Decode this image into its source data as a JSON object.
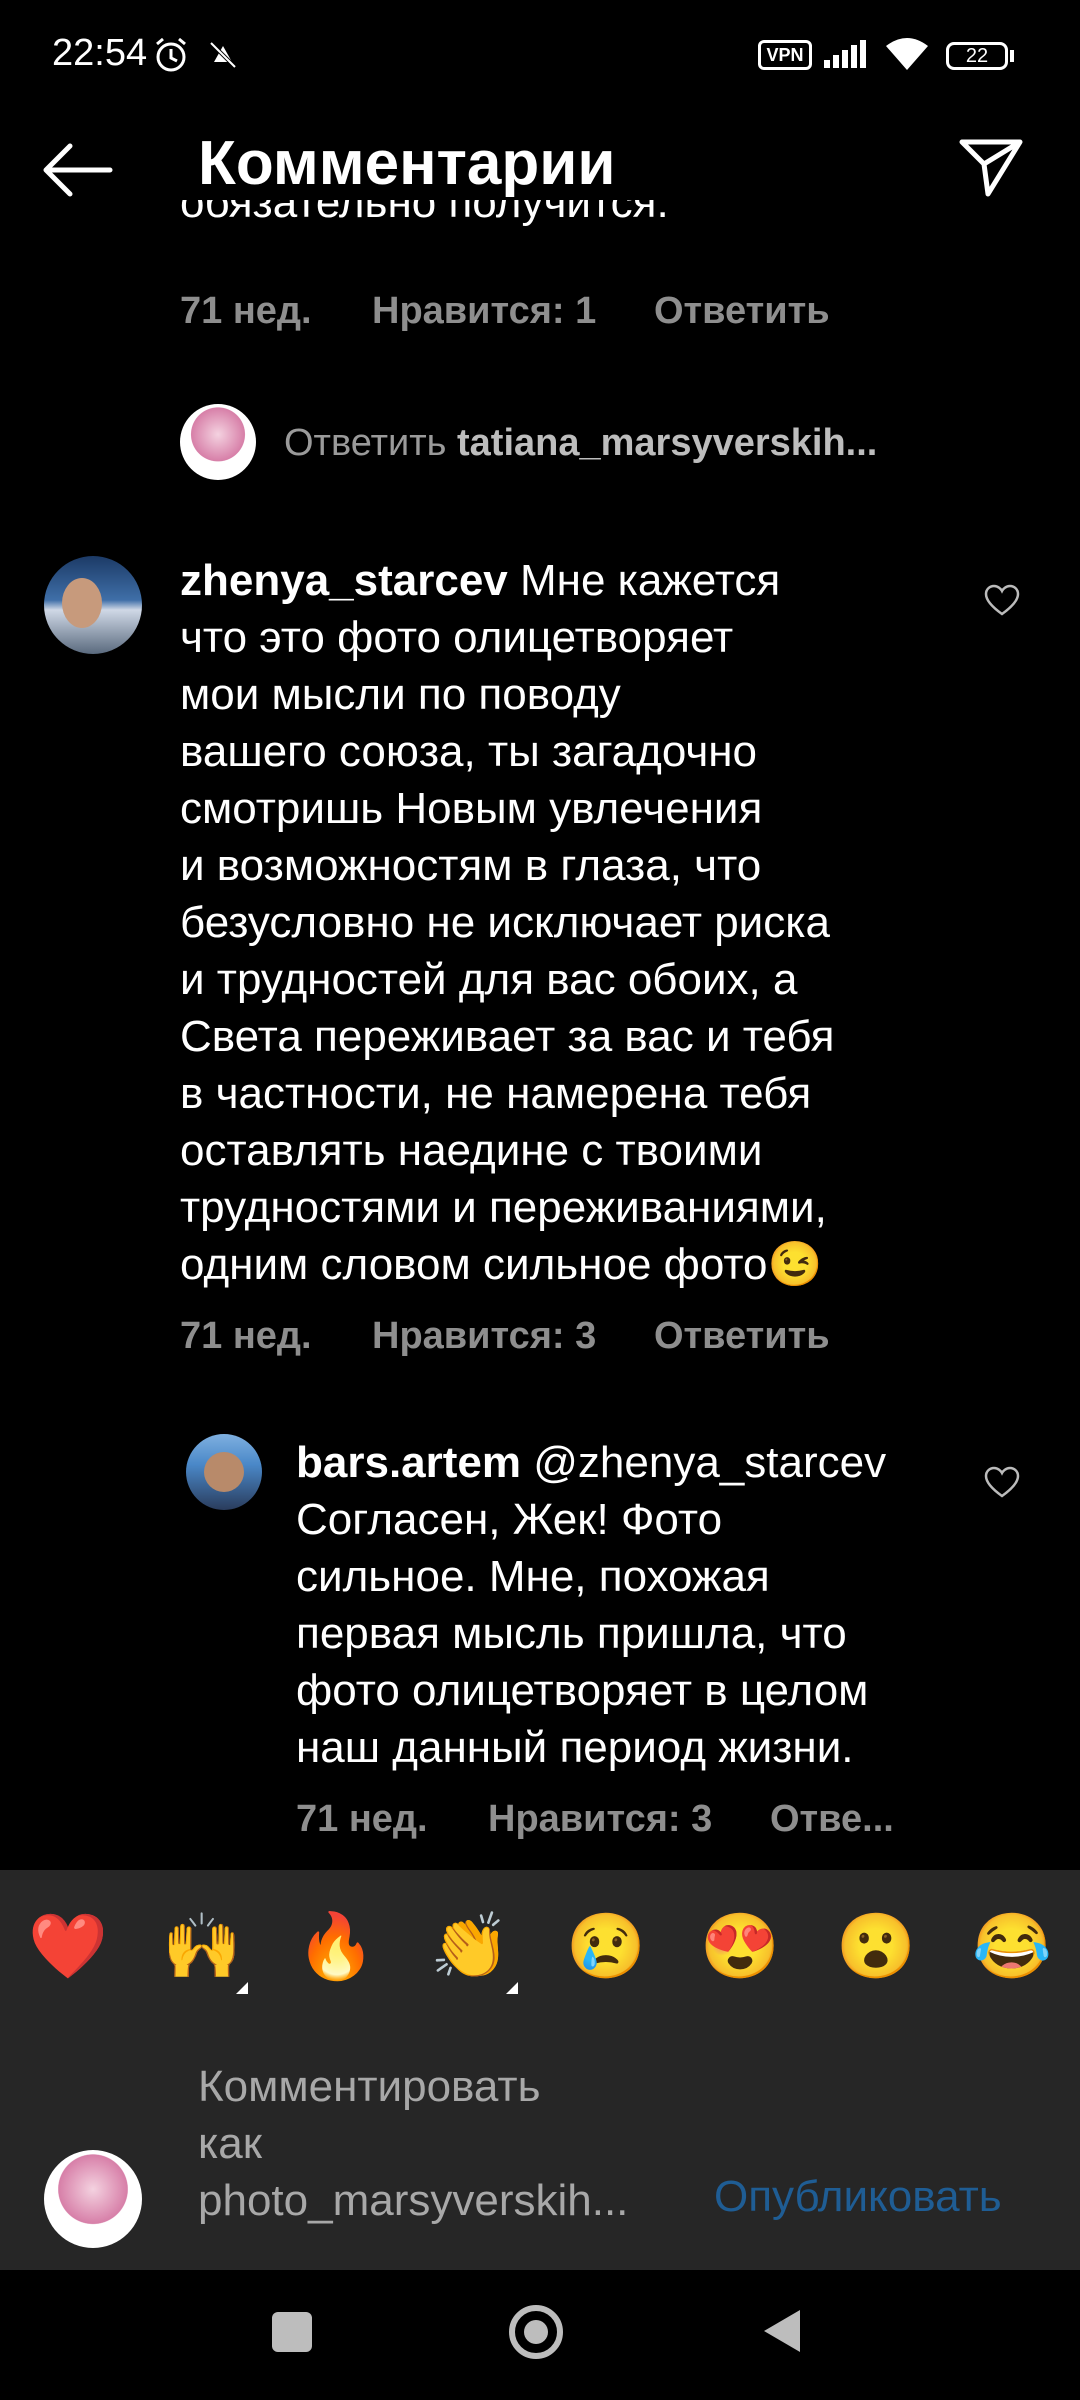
{
  "status": {
    "time": "22:54",
    "battery": "22",
    "vpn": "VPN"
  },
  "header": {
    "title": "Комментарии"
  },
  "partial_comment": {
    "text": "обязательно получится.",
    "time": "71 нед.",
    "likes": "Нравится: 1",
    "reply": "Ответить"
  },
  "reply_prompt": {
    "prefix": "Ответить ",
    "user": "tatiana_marsyverskih..."
  },
  "comment1": {
    "user": "zhenya_starcev",
    "lines": [
      "Мне кажется",
      "что это фото олицетворяет",
      "мои мысли по поводу",
      "вашего союза, ты загадочно",
      "смотришь Новым увлечения",
      "и возможностям в глаза, что",
      "безусловно не исключает риска",
      "и трудностей для вас обоих, а",
      "Света переживает за вас и тебя",
      "в частности, не намерена тебя",
      "оставлять наедине с твоими",
      "трудностями и переживаниями,",
      "одним словом сильное фото😉"
    ],
    "time": "71 нед.",
    "likes": "Нравится: 3",
    "reply": "Ответить"
  },
  "comment2": {
    "user": "bars.artem",
    "mention": "@zhenya_starcev",
    "lines": [
      "Согласен, Жек! Фото",
      "сильное. Мне, похожая",
      "первая мысль пришла, что",
      "фото олицетворяет в целом",
      "наш данный период жизни."
    ],
    "time": "71 нед.",
    "likes": "Нравится: 3",
    "reply": "Отве..."
  },
  "emojis": [
    "❤️",
    "🙌",
    "🔥",
    "👏",
    "😢",
    "😍",
    "😮",
    "😂"
  ],
  "input": {
    "placeholder_lines": [
      "Комментировать",
      "как",
      "photo_marsyverskih..."
    ],
    "publish": "Опубликовать"
  }
}
